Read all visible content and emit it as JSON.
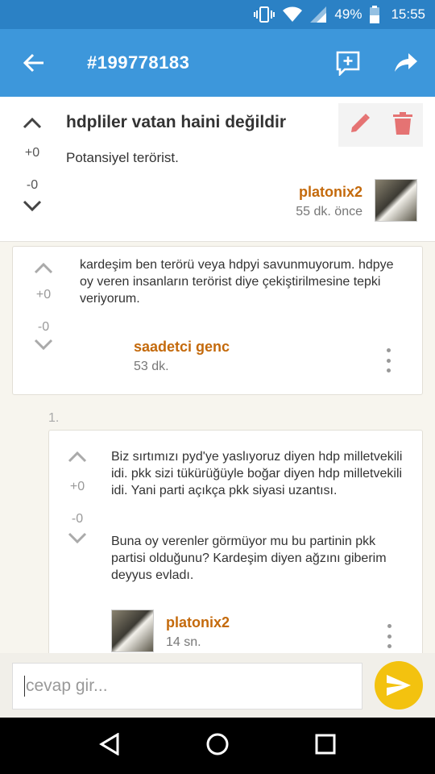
{
  "status_bar": {
    "battery_percent": "49%",
    "time": "15:55"
  },
  "app_bar": {
    "title": "#199778183"
  },
  "post": {
    "title": "hdpliler vatan haini değildir",
    "body": "Potansiyel terörist.",
    "up_votes": "+0",
    "down_votes": "-0",
    "author": "platonix2",
    "time": "55 dk. önce"
  },
  "comments": [
    {
      "text": "kardeşim ben terörü veya hdpyi savunmuyorum. hdpye oy veren insanların terörist diye çekiştirilmesine tepki veriyorum.",
      "up_votes": "+0",
      "down_votes": "-0",
      "author": "saadetci genc",
      "time": "53 dk."
    }
  ],
  "reply_index": "1.",
  "reply": {
    "paragraph1": "Biz sırtımızı pyd'ye yaslıyoruz diyen hdp milletvekili idi. pkk sizi tükürüğüyle boğar diyen hdp milletvekili idi. Yani parti açıkça pkk siyasi uzantısı.",
    "paragraph2": "Buna oy verenler görmüyor mu bu partinin pkk partisi olduğunu? Kardeşim diyen ağzını giberim deyyus evladı.",
    "up_votes": "+0",
    "down_votes": "-0",
    "author": "platonix2",
    "time": "14 sn."
  },
  "input": {
    "placeholder": "cevap gir..."
  },
  "colors": {
    "primary": "#3d97db",
    "status_bar": "#2b81c5",
    "author": "#c46a0c",
    "send": "#f3c20f",
    "delete": "#e57373"
  }
}
